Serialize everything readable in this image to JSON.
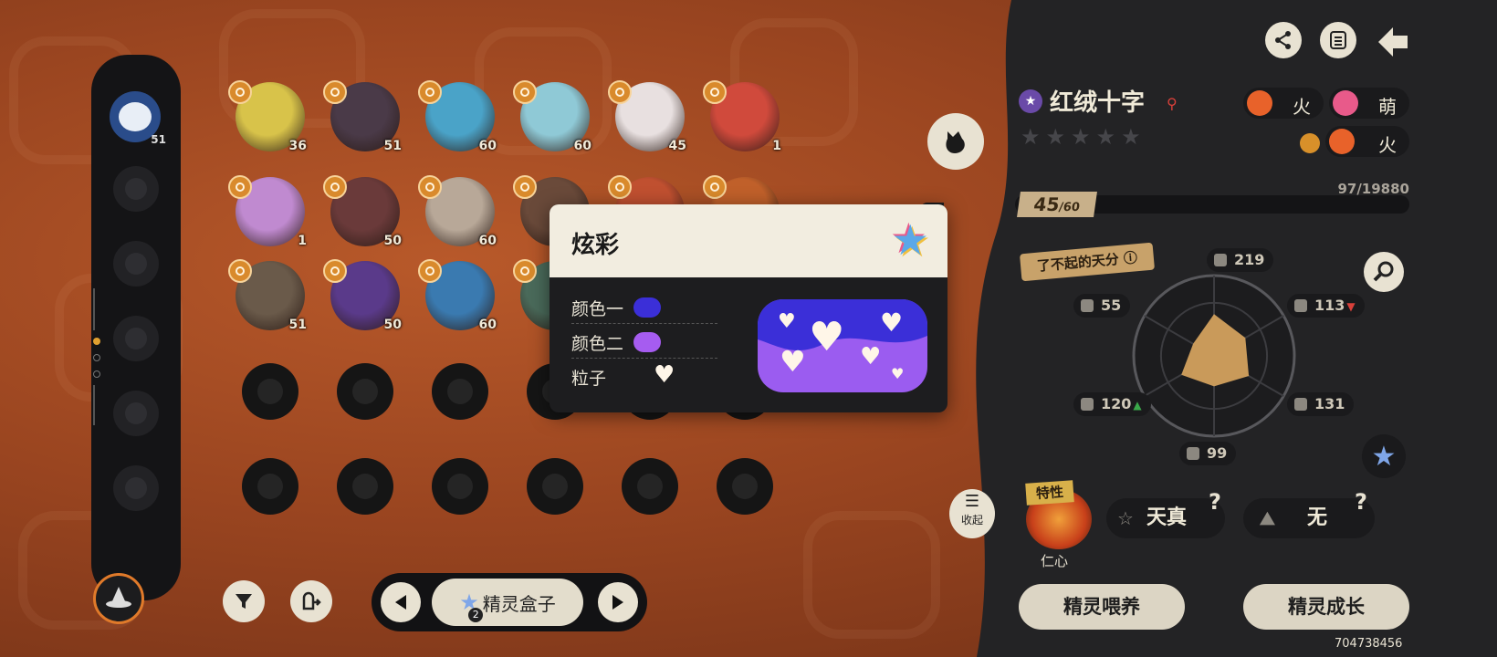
{
  "left_column": {
    "avatar_level": "51"
  },
  "grid": {
    "row1": [
      {
        "level": "36",
        "color": "#d8c34a"
      },
      {
        "level": "51",
        "color": "#4a3a48"
      },
      {
        "level": "60",
        "color": "#4aa3c8"
      },
      {
        "level": "60",
        "color": "#8fc9d6"
      },
      {
        "level": "45",
        "color": "#e8e0e0"
      },
      {
        "level": "1",
        "color": "#d04a3c"
      }
    ],
    "row2": [
      {
        "level": "1",
        "color": "#c08ad0"
      },
      {
        "level": "50",
        "color": "#6a3a3a"
      },
      {
        "level": "60",
        "color": "#b8a898"
      },
      {
        "level": "",
        "color": "#6a4a3a"
      },
      {
        "level": "",
        "color": "#c05030"
      },
      {
        "level": "",
        "color": "#c0602a"
      }
    ],
    "row3": [
      {
        "level": "51",
        "color": "#6a5a4a"
      },
      {
        "level": "50",
        "color": "#5a3a8a"
      },
      {
        "level": "60",
        "color": "#3a7ab0"
      },
      {
        "level": "",
        "color": "#4a6a5a"
      }
    ]
  },
  "bottom_bar": {
    "box_label": "精灵盒子",
    "box_badge": "2"
  },
  "popup": {
    "title": "炫彩",
    "color1_label": "颜色一",
    "color1": "#3b2fd8",
    "color2_label": "颜色二",
    "color2": "#a65cf0",
    "particle_label": "粒子",
    "particle_icon": "heart-icon"
  },
  "pet": {
    "name": "红绒十字",
    "star_count": "5",
    "element1": "火",
    "element2": "萌",
    "element3": "火",
    "level": "45",
    "level_max": "/60",
    "exp": "97/19880",
    "talent_label": "了不起的天分",
    "stats": {
      "hp": "219",
      "attack": "113",
      "defense": "131",
      "speed": "99",
      "sp_defense": "120",
      "sp_attack": "55"
    },
    "trait_tag": "特性",
    "trait_name": "仁心",
    "nature": "天真",
    "nature2": "无",
    "collapse_label": "收起"
  },
  "buttons": {
    "feed": "精灵喂养",
    "grow": "精灵成长"
  },
  "footer_id": "704738456",
  "radar": {
    "hp": 0.52,
    "attack": 0.45,
    "defense": 0.5,
    "speed": 0.38,
    "sp_defense": 0.47,
    "sp_attack": 0.3
  }
}
